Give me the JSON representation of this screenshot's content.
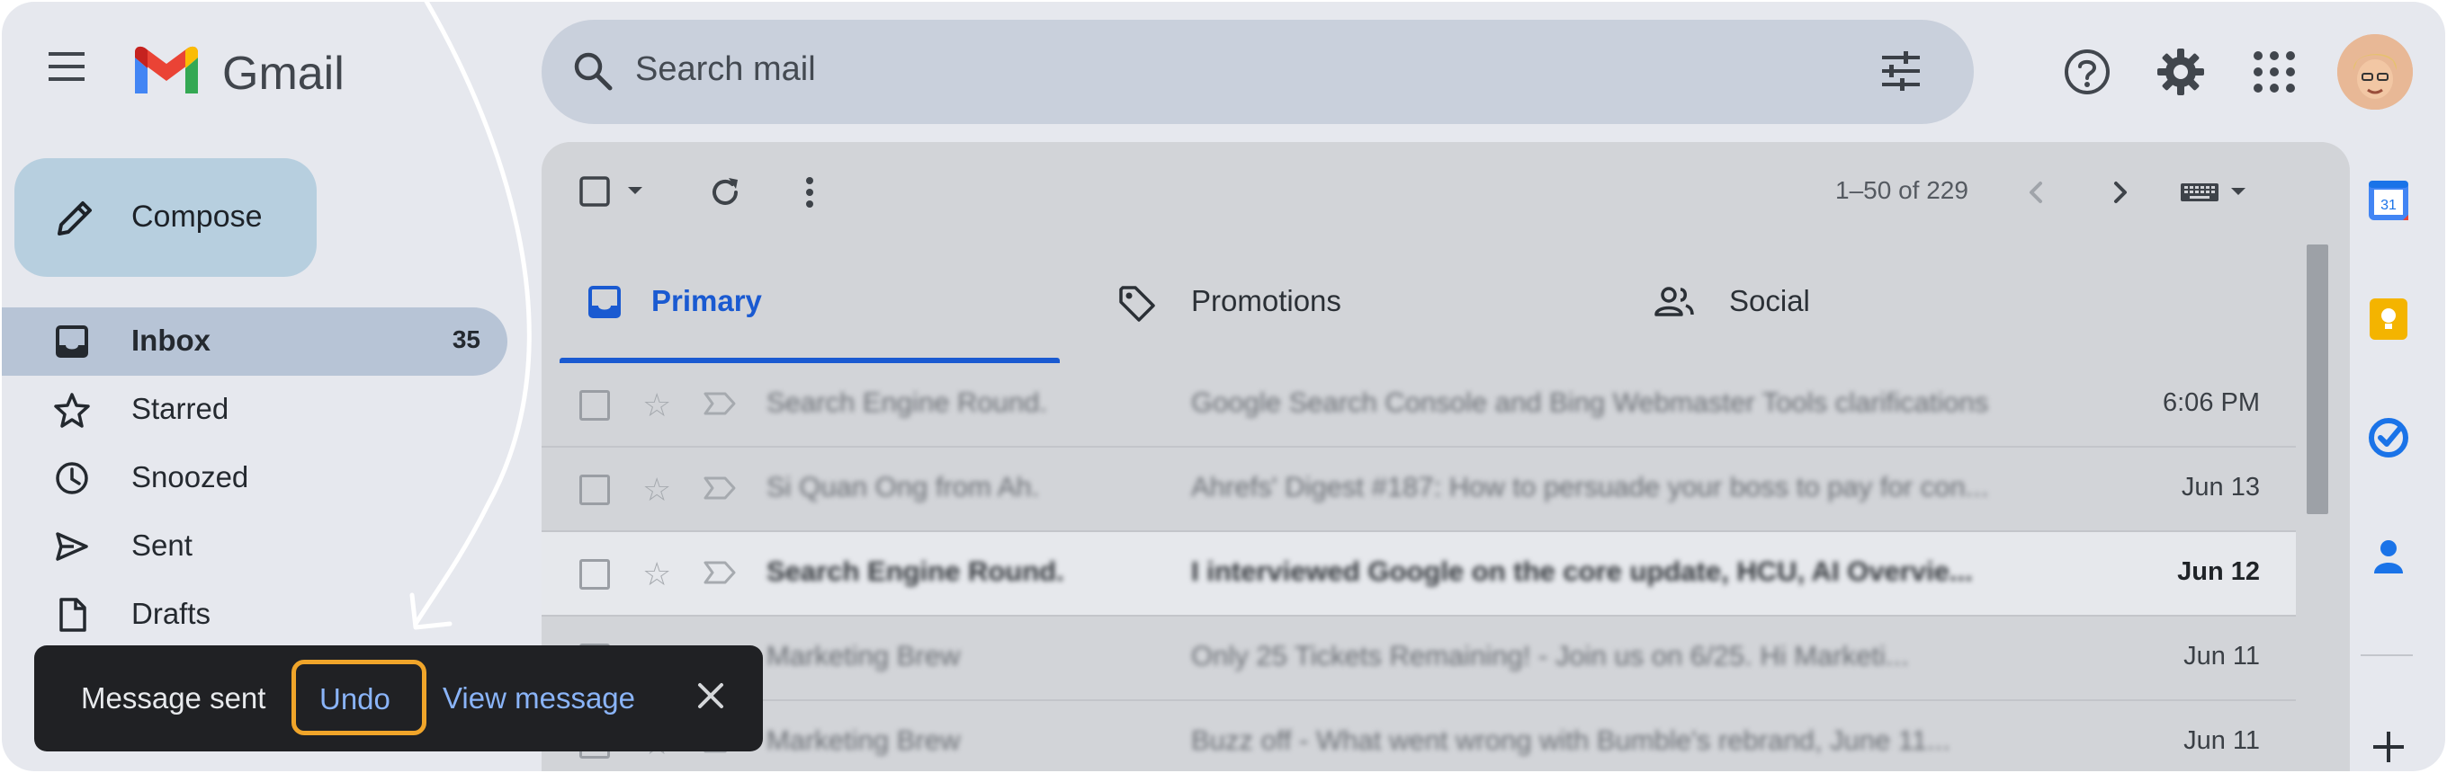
{
  "app": {
    "brand": "Gmail"
  },
  "search": {
    "placeholder": "Search mail"
  },
  "compose": {
    "label": "Compose"
  },
  "sidebar": {
    "items": [
      {
        "label": "Inbox",
        "count": "35",
        "icon": "inbox-icon",
        "active": true
      },
      {
        "label": "Starred",
        "count": "",
        "icon": "star-icon"
      },
      {
        "label": "Snoozed",
        "count": "",
        "icon": "clock-icon"
      },
      {
        "label": "Sent",
        "count": "",
        "icon": "send-icon"
      },
      {
        "label": "Drafts",
        "count": "",
        "icon": "draft-icon"
      }
    ]
  },
  "toolbar": {
    "paging": "1–50 of 229"
  },
  "tabs": [
    {
      "label": "Primary",
      "icon": "inbox-icon",
      "active": true
    },
    {
      "label": "Promotions",
      "icon": "tag-icon"
    },
    {
      "label": "Social",
      "icon": "people-icon"
    }
  ],
  "emails": [
    {
      "sender": "Search Engine Round.",
      "subject": "Google Search Console and Bing Webmaster Tools clarifications",
      "date": "6:06 PM",
      "unread": false
    },
    {
      "sender": "Si Quan Ong from Ah.",
      "subject": "Ahrefs' Digest #187: How to persuade your boss to pay for con...",
      "date": "Jun 13",
      "unread": false
    },
    {
      "sender": "Search Engine Round.",
      "subject": "I interviewed Google on the core update, HCU, AI Overvie...",
      "date": "Jun 12",
      "unread": true
    },
    {
      "sender": "Marketing Brew",
      "subject": "Only 25 Tickets Remaining! - Join us on 6/25. Hi Marketi...",
      "date": "Jun 11",
      "unread": false
    },
    {
      "sender": "Marketing Brew",
      "subject": "Buzz off - What went wrong with Bumble's rebrand, June 11...",
      "date": "Jun 11",
      "unread": false
    }
  ],
  "snackbar": {
    "message": "Message sent",
    "undo": "Undo",
    "view": "View message"
  },
  "rail": {
    "calendar_day": "31"
  },
  "colors": {
    "accent": "#1a5ad1",
    "link": "#8ab4f8",
    "highlight": "#f0a52a",
    "snackbar_bg": "#202124"
  }
}
